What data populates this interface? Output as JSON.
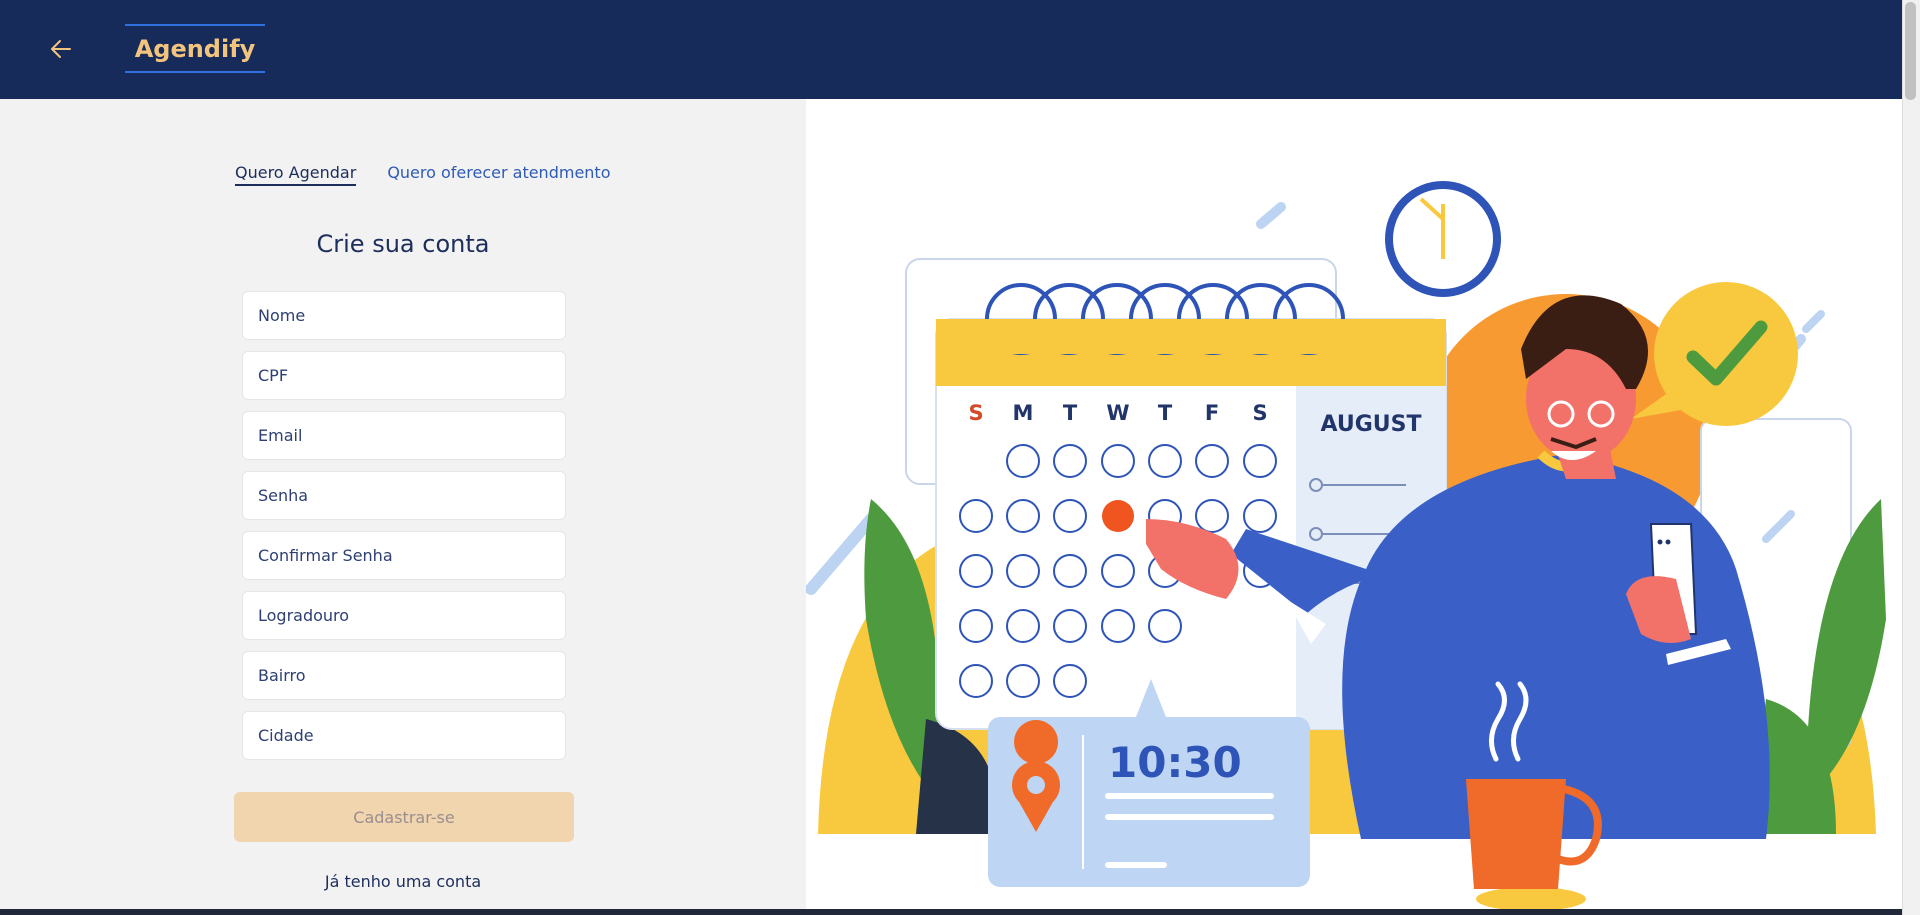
{
  "header": {
    "back_icon": "arrow-left-icon",
    "brand": "Agendify"
  },
  "tabs": [
    {
      "label": "Quero Agendar",
      "active": true
    },
    {
      "label": "Quero oferecer atendmento",
      "active": false
    }
  ],
  "form": {
    "title": "Crie sua conta",
    "fields": [
      {
        "placeholder": "Nome",
        "value": ""
      },
      {
        "placeholder": "CPF",
        "value": ""
      },
      {
        "placeholder": "Email",
        "value": ""
      },
      {
        "placeholder": "Senha",
        "value": ""
      },
      {
        "placeholder": "Confirmar Senha",
        "value": ""
      },
      {
        "placeholder": "Logradouro",
        "value": ""
      },
      {
        "placeholder": "Bairro",
        "value": ""
      },
      {
        "placeholder": "Cidade",
        "value": ""
      }
    ],
    "submit_label": "Cadastrar-se",
    "login_link": "Já tenho uma conta"
  },
  "illustration": {
    "calendar_month": "AUGUST",
    "weekdays": [
      "S",
      "M",
      "T",
      "W",
      "T",
      "F",
      "S"
    ],
    "time": "10:30"
  },
  "colors": {
    "header_bg": "#172b5a",
    "brand": "#f2c47e",
    "submit_bg": "#f0d5ae",
    "panel_bg": "#f2f2f2"
  }
}
